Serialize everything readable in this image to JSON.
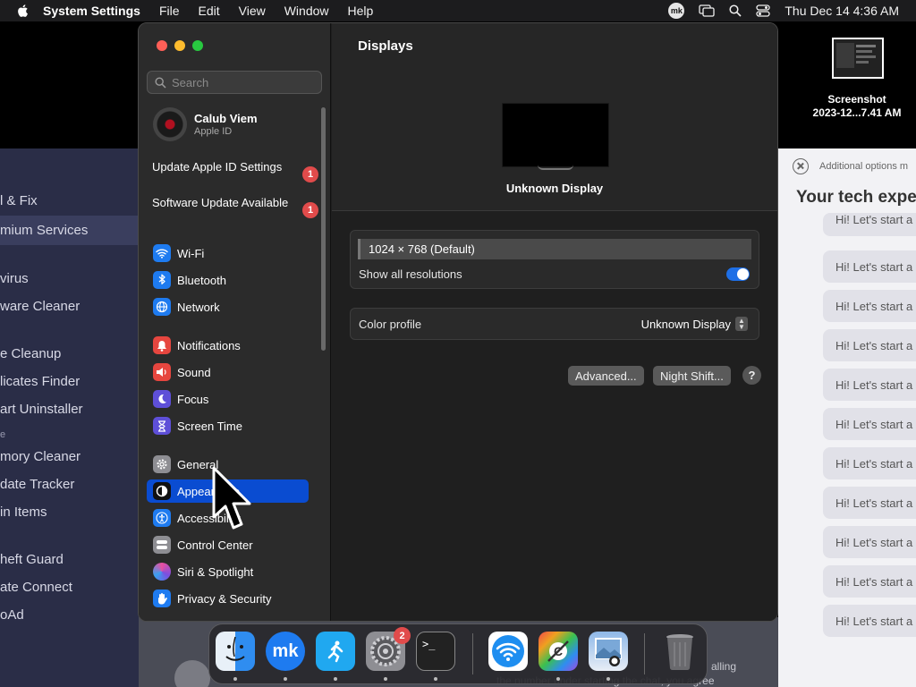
{
  "menubar": {
    "app_name": "System Settings",
    "menus": [
      "File",
      "Edit",
      "View",
      "Window",
      "Help"
    ],
    "status_avatar": "mk",
    "clock": "Thu Dec 14  4:36 AM"
  },
  "desktop": {
    "screenshot_label_line1": "Screenshot",
    "screenshot_label_line2": "2023-12...7.41 AM"
  },
  "background_left": {
    "items": [
      "l & Fix",
      "mium Services",
      "virus",
      "ware Cleaner",
      "e Cleanup",
      "licates Finder",
      "art Uninstaller",
      "e",
      "mory Cleaner",
      "date Tracker",
      "in Items",
      "heft Guard",
      "ate Connect",
      "oAd"
    ]
  },
  "background_right": {
    "top_text": "Additional options m",
    "heading": "Your tech expe",
    "partial_top": "Hi! Let's start a",
    "message": "Hi! Let's start a"
  },
  "background_bottom": {
    "text1": "alling",
    "text2": "the number under starting the chat, you agree"
  },
  "window": {
    "search": {
      "placeholder": "Search"
    },
    "user": {
      "name": "Calub Viem",
      "subtitle": "Apple ID"
    },
    "updates": [
      {
        "label": "Update Apple ID Settings",
        "count": "1"
      },
      {
        "label": "Software Update Available",
        "count": "1"
      }
    ],
    "sidebar_group1": [
      {
        "label": "Wi-Fi",
        "icon": "wifi-icon",
        "color": "#1e7bf0"
      },
      {
        "label": "Bluetooth",
        "icon": "bluetooth-icon",
        "color": "#1e7bf0"
      },
      {
        "label": "Network",
        "icon": "globe-icon",
        "color": "#1e7bf0"
      }
    ],
    "sidebar_group2": [
      {
        "label": "Notifications",
        "icon": "bell-icon",
        "color": "#e6463f"
      },
      {
        "label": "Sound",
        "icon": "speaker-icon",
        "color": "#e6463f"
      },
      {
        "label": "Focus",
        "icon": "moon-icon",
        "color": "#5e4fd8"
      },
      {
        "label": "Screen Time",
        "icon": "hourglass-icon",
        "color": "#5e4fd8"
      }
    ],
    "sidebar_group3": [
      {
        "label": "General",
        "icon": "gear-icon",
        "color": "#8e8e93"
      },
      {
        "label": "Appearance",
        "icon": "appearance-icon",
        "color": "#111111"
      },
      {
        "label": "Accessibility",
        "icon": "accessibility-icon",
        "color": "#1e7bf0"
      },
      {
        "label": "Control Center",
        "icon": "control-center-icon",
        "color": "#8e8e93"
      },
      {
        "label": "Siri & Spotlight",
        "icon": "siri-icon",
        "color": "#8a3fd8"
      },
      {
        "label": "Privacy & Security",
        "icon": "hand-icon",
        "color": "#1e7bf0"
      }
    ],
    "selected_item": "Appearance",
    "main": {
      "title": "Displays",
      "display_name": "Unknown Display",
      "resolution": "1024 × 768 (Default)",
      "show_all_label": "Show all resolutions",
      "show_all_on": true,
      "color_profile_label": "Color profile",
      "color_profile_value": "Unknown Display",
      "advanced_button": "Advanced...",
      "night_shift_button": "Night Shift...",
      "help_button": "?"
    }
  },
  "dock": {
    "apps": [
      {
        "name": "Finder",
        "icon": "finder-icon",
        "running": true
      },
      {
        "name": "MacKeeper",
        "icon": "mackeeper-icon",
        "running": true
      },
      {
        "name": "Fitness",
        "icon": "runner-icon",
        "running": true
      },
      {
        "name": "System Settings",
        "icon": "settings-gear-icon",
        "running": true,
        "badge": "2"
      },
      {
        "name": "Terminal",
        "icon": "terminal-icon",
        "running": true
      },
      {
        "name": "Wireless Diagnostics",
        "icon": "wifi-diagnostics-icon",
        "running": false
      },
      {
        "name": "System Toolkit",
        "icon": "toolkit-icon",
        "running": true
      },
      {
        "name": "Preview",
        "icon": "preview-icon",
        "running": true
      },
      {
        "name": "Trash",
        "icon": "trash-icon",
        "running": false
      }
    ]
  }
}
